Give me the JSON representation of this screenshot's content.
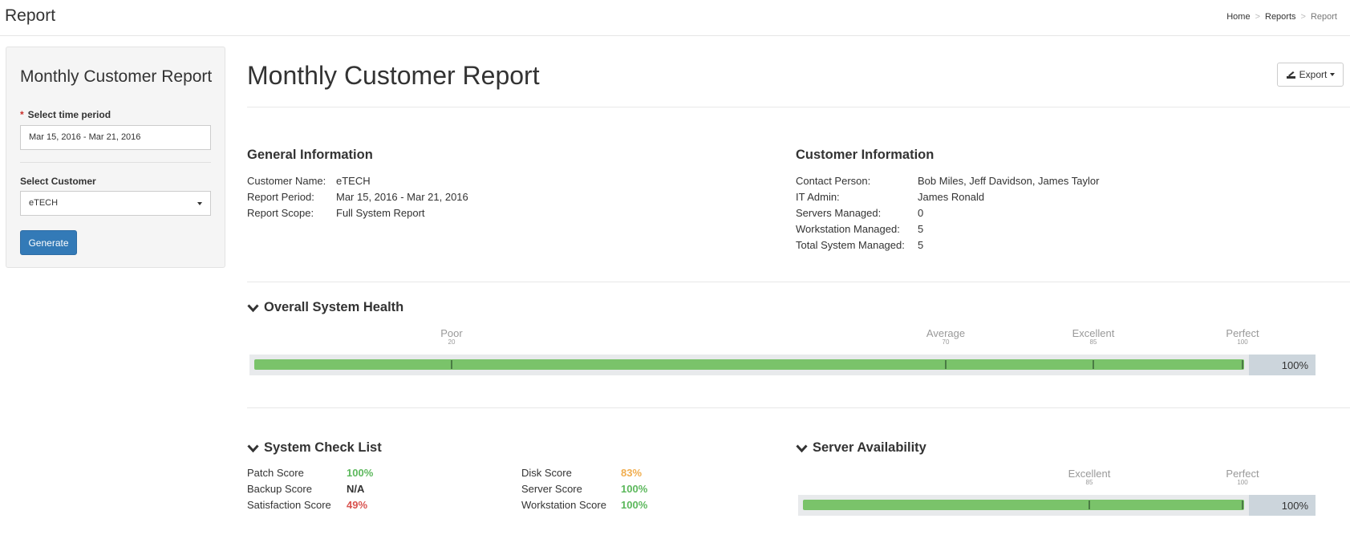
{
  "app": {
    "title": "Report"
  },
  "breadcrumb": [
    "Home",
    "Reports",
    "Report"
  ],
  "sidebar": {
    "title": "Monthly Customer Report",
    "time_period_label": "Select time period",
    "time_period_value": "Mar 15, 2016 - Mar 21, 2016",
    "customer_label": "Select Customer",
    "customer_value": "eTECH",
    "generate_label": "Generate"
  },
  "main": {
    "title": "Monthly Customer Report",
    "export_label": "Export"
  },
  "general_info": {
    "heading": "General Information",
    "rows": [
      {
        "k": "Customer Name:",
        "v": "eTECH"
      },
      {
        "k": "Report Period:",
        "v": "Mar 15, 2016 - Mar 21, 2016"
      },
      {
        "k": "Report Scope:",
        "v": "Full System Report"
      }
    ]
  },
  "customer_info": {
    "heading": "Customer Information",
    "rows": [
      {
        "k": "Contact Person:",
        "v": "Bob Miles, Jeff Davidson, James Taylor"
      },
      {
        "k": "IT Admin:",
        "v": "James Ronald"
      },
      {
        "k": "Servers Managed:",
        "v": "0"
      },
      {
        "k": "Workstation Managed:",
        "v": "5"
      },
      {
        "k": "Total System Managed:",
        "v": "5"
      }
    ]
  },
  "overall_health": {
    "heading": "Overall System Health",
    "value": 100,
    "value_text": "100%",
    "markers": [
      {
        "name": "Poor",
        "num": "20"
      },
      {
        "name": "Average",
        "num": "70"
      },
      {
        "name": "Excellent",
        "num": "85"
      },
      {
        "name": "Perfect",
        "num": "100"
      }
    ]
  },
  "checklist": {
    "heading": "System Check List",
    "left": [
      {
        "k": "Patch Score",
        "v": "100%",
        "color": "#5cb85c"
      },
      {
        "k": "Backup Score",
        "v": "N/A",
        "color": "#333333"
      },
      {
        "k": "Satisfaction Score",
        "v": "49%",
        "color": "#d9534f"
      }
    ],
    "right": [
      {
        "k": "Disk Score",
        "v": "83%",
        "color": "#f0ad4e"
      },
      {
        "k": "Server Score",
        "v": "100%",
        "color": "#5cb85c"
      },
      {
        "k": "Workstation Score",
        "v": "100%",
        "color": "#5cb85c"
      }
    ]
  },
  "server_availability": {
    "heading": "Server Availability",
    "value": 100,
    "value_text": "100%",
    "markers": [
      {
        "name": "Excellent",
        "num": "85"
      },
      {
        "name": "Perfect",
        "num": "100"
      }
    ]
  },
  "colors": {
    "primary": "#337ab7",
    "bar_fill": "#7ac36a",
    "danger": "#d9534f",
    "warning": "#f0ad4e",
    "success": "#5cb85c"
  }
}
